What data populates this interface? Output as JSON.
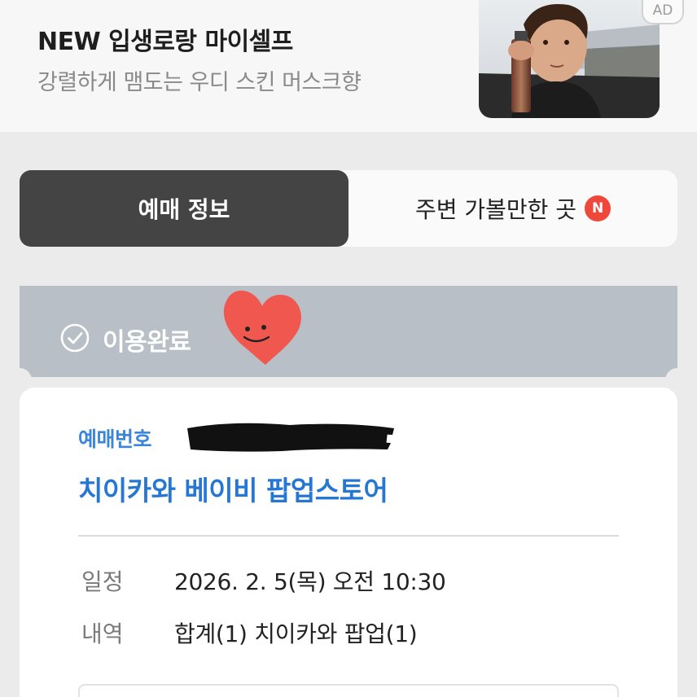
{
  "ad": {
    "title": "NEW 입생로랑 마이셀프",
    "subtitle": "강렬하게 맴도는 우디 스킨 머스크향",
    "badge": "AD"
  },
  "tabs": [
    {
      "label": "예매 정보",
      "active": true
    },
    {
      "label": "주변 가볼만한 곳",
      "badge": "N",
      "active": false
    }
  ],
  "status": {
    "label": "이용완료",
    "icon": "check-circle-icon"
  },
  "ticket": {
    "booking_label": "예매번호",
    "event_title": "치이카와 베이비 팝업스토어",
    "rows": [
      {
        "label": "일정",
        "value": "2026. 2. 5(목) 오전 10:30"
      },
      {
        "label": "내역",
        "value": "합계(1) 치이카와 팝업(1)"
      }
    ]
  },
  "colors": {
    "background": "#ebebeb",
    "active_tab": "#444444",
    "status_bar": "#b9bfc7",
    "accent_blue": "#2677d4",
    "new_badge": "#f0473b",
    "heart_sticker": "#f0584f"
  }
}
